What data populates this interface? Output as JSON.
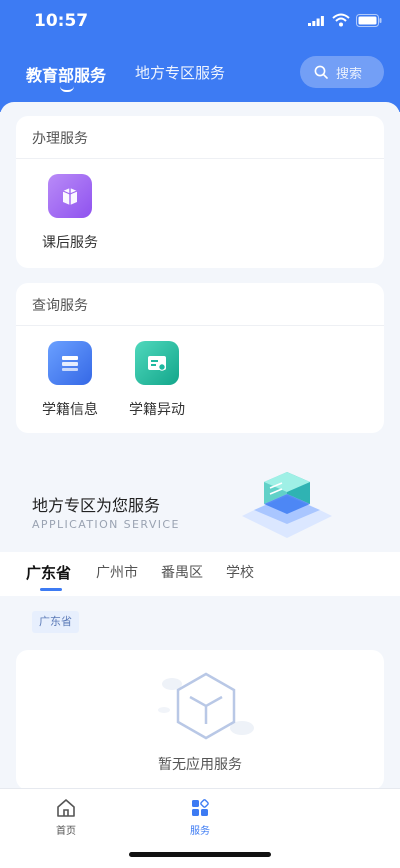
{
  "status": {
    "time": "10:57"
  },
  "header": {
    "tabs": [
      {
        "label": "教育部服务",
        "active": true
      },
      {
        "label": "地方专区服务",
        "active": false
      }
    ],
    "search_placeholder": "搜索"
  },
  "handling": {
    "title": "办理服务",
    "items": [
      {
        "label": "课后服务",
        "icon": "book-box-icon",
        "color": "#a066f2"
      }
    ]
  },
  "query": {
    "title": "查询服务",
    "items": [
      {
        "label": "学籍信息",
        "icon": "student-record-icon",
        "color": "#3d7bf3"
      },
      {
        "label": "学籍异动",
        "icon": "record-change-icon",
        "color": "#1fb9a0"
      }
    ]
  },
  "promo": {
    "title": "地方专区为您服务",
    "subtitle": "APPLICATION SERVICE"
  },
  "region_tabs": [
    "广东省",
    "广州市",
    "番禺区",
    "学校"
  ],
  "region_chip": "广东省",
  "empty_state": {
    "text": "暂无应用服务"
  },
  "bottom_nav": [
    {
      "label": "首页",
      "icon": "home-icon",
      "active": false
    },
    {
      "label": "服务",
      "icon": "apps-icon",
      "active": true
    }
  ],
  "colors": {
    "primary": "#3d7bf3",
    "background": "#f3f6fb"
  }
}
